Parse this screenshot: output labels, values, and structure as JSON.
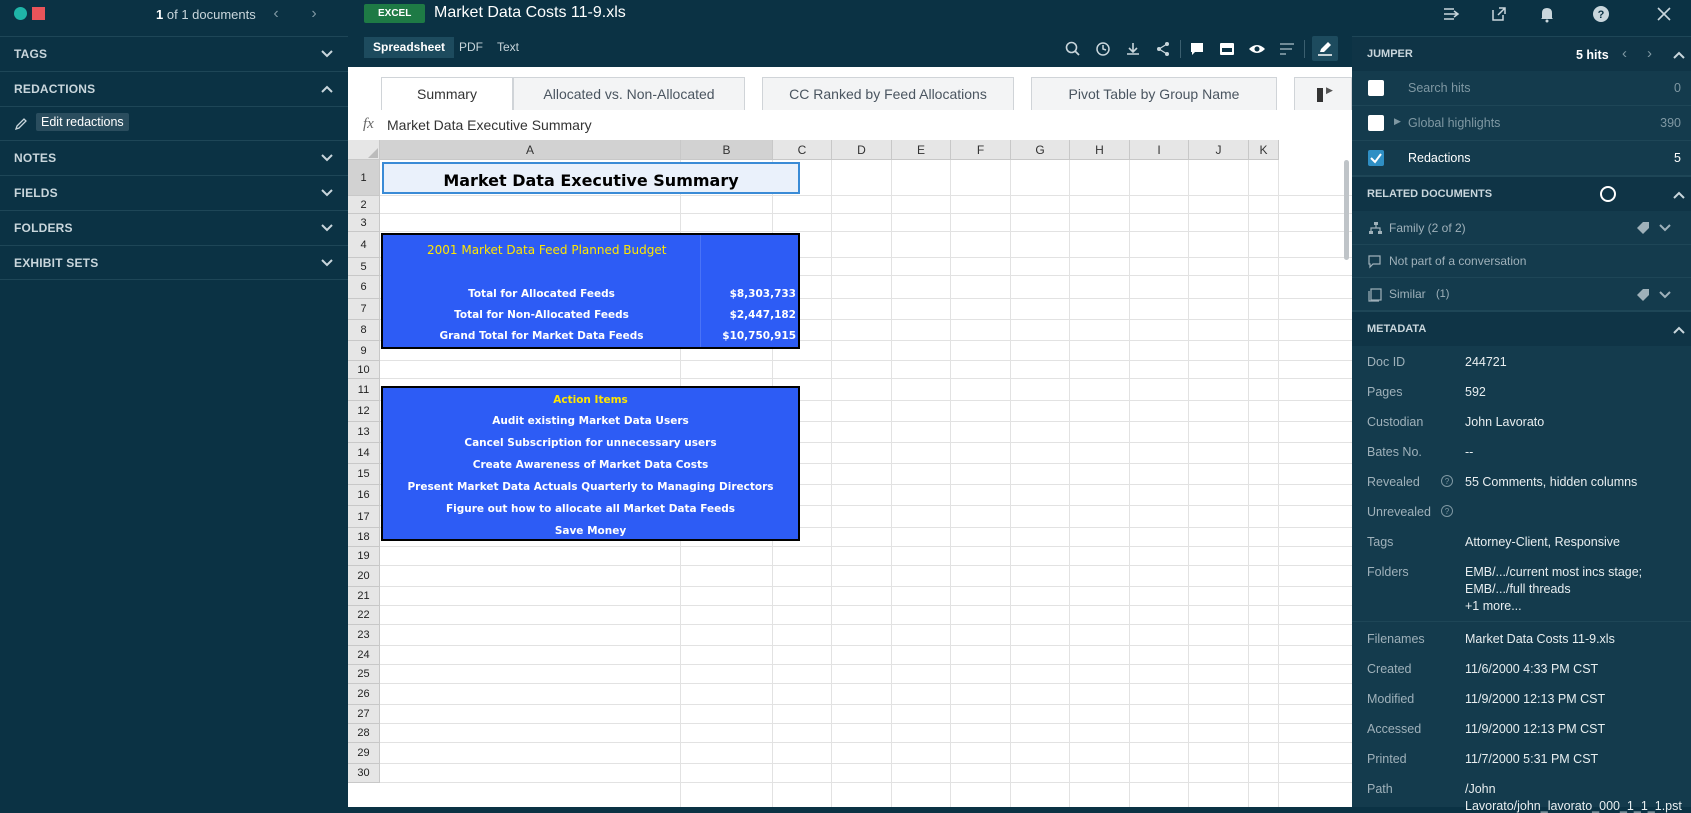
{
  "left": {
    "doc_count_num": "1",
    "doc_count_text": "of 1 documents",
    "sections": [
      "TAGS",
      "REDACTIONS",
      "NOTES",
      "FIELDS",
      "FOLDERS",
      "EXHIBIT SETS"
    ],
    "edit_redactions": "Edit redactions"
  },
  "header": {
    "badge": "EXCEL",
    "title": "Market Data Costs 11-9.xls"
  },
  "viewtabs": [
    "Spreadsheet",
    "PDF",
    "Text"
  ],
  "sheet_tabs": [
    "Summary",
    "Allocated vs. Non-Allocated",
    "CC Ranked by Feed Allocations",
    "Pivot Table by Group Name"
  ],
  "formula": {
    "fx": "fx",
    "value": "Market Data Executive Summary"
  },
  "columns": [
    "A",
    "B",
    "C",
    "D",
    "E",
    "F",
    "G",
    "H",
    "I",
    "J",
    "K"
  ],
  "rows": [
    "1",
    "2",
    "3",
    "4",
    "5",
    "6",
    "7",
    "8",
    "9",
    "10",
    "11",
    "12",
    "13",
    "14",
    "15",
    "16",
    "17",
    "18",
    "19",
    "20",
    "21",
    "22",
    "23",
    "24",
    "25",
    "26",
    "27",
    "28",
    "29",
    "30"
  ],
  "sheet": {
    "title": "Market Data Executive Summary",
    "budget_title": "2001 Market Data Feed Planned Budget",
    "lines": [
      {
        "label": "Total for Allocated Feeds",
        "value": "$8,303,733"
      },
      {
        "label": "Total for Non-Allocated Feeds",
        "value": "$2,447,182"
      },
      {
        "label": "Grand Total for Market Data Feeds",
        "value": "$10,750,915"
      }
    ],
    "action_title": "Action Items",
    "actions": [
      "Audit existing Market Data Users",
      "Cancel Subscription for unnecessary users",
      "Create Awareness of Market Data Costs",
      "Present Market Data Actuals Quarterly to Managing Directors",
      "Figure out how to allocate all Market Data Feeds",
      "Save Money"
    ]
  },
  "jumper": {
    "title": "JUMPER",
    "hits": "5 hits",
    "rows": [
      {
        "label": "Search hits",
        "count": "0"
      },
      {
        "label": "Global highlights",
        "count": "390"
      },
      {
        "label": "Redactions",
        "count": "5"
      }
    ]
  },
  "related": {
    "title": "RELATED DOCUMENTS",
    "family": "Family (2 of 2)",
    "conversation": "Not part of a conversation",
    "similar": "Similar",
    "similar_count": "(1)"
  },
  "metadata": {
    "title": "METADATA",
    "items": [
      {
        "key": "Doc ID",
        "value": "244721"
      },
      {
        "key": "Pages",
        "value": "592"
      },
      {
        "key": "Custodian",
        "value": "John Lavorato"
      },
      {
        "key": "Bates No.",
        "value": "--"
      },
      {
        "key": "Revealed",
        "value": "55 Comments, hidden columns"
      },
      {
        "key": "Unrevealed",
        "value": ""
      },
      {
        "key": "Tags",
        "value": "Attorney-Client, Responsive"
      },
      {
        "key": "Folders",
        "value": "EMB/.../current most incs stage;"
      },
      {
        "key": "Folders2",
        "value": "EMB/.../full threads"
      },
      {
        "key": "Folders3",
        "value": "+1 more..."
      },
      {
        "key": "Filenames",
        "value": "Market Data Costs 11-9.xls"
      },
      {
        "key": "Created",
        "value": "11/6/2000 4:33 PM CST"
      },
      {
        "key": "Modified",
        "value": "11/9/2000 12:13 PM CST"
      },
      {
        "key": "Accessed",
        "value": "11/9/2000 12:13 PM CST"
      },
      {
        "key": "Printed",
        "value": "11/7/2000 5:31 PM CST"
      },
      {
        "key": "Path",
        "value": "/John"
      },
      {
        "key": "Path2",
        "value": "Lavorato/john_lavorato_000_1_1_1.pst"
      }
    ]
  },
  "colors": {
    "teal": "#1fb5a8",
    "red": "#e8545a",
    "excel_green": "#1e7a45",
    "cell_blue": "#2d5cf5",
    "yellow": "#ffe600"
  }
}
